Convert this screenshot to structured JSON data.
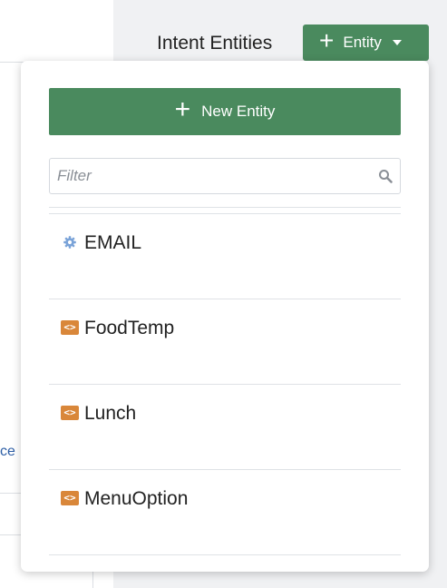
{
  "background": {
    "left_link_text": "ce"
  },
  "header": {
    "title": "Intent Entities",
    "entity_button_label": "Entity"
  },
  "popup": {
    "new_entity_label": "New Entity",
    "filter_placeholder": "Filter",
    "filter_value": "",
    "entities": [
      {
        "label": "EMAIL",
        "icon": "gear-icon"
      },
      {
        "label": "FoodTemp",
        "icon": "code-icon"
      },
      {
        "label": "Lunch",
        "icon": "code-icon"
      },
      {
        "label": "MenuOption",
        "icon": "code-icon"
      }
    ]
  },
  "colors": {
    "accent_green": "#4a8a5e",
    "code_icon": "#d9873a",
    "gear_icon": "#7aa3d8",
    "link_blue": "#2e5fa6"
  }
}
